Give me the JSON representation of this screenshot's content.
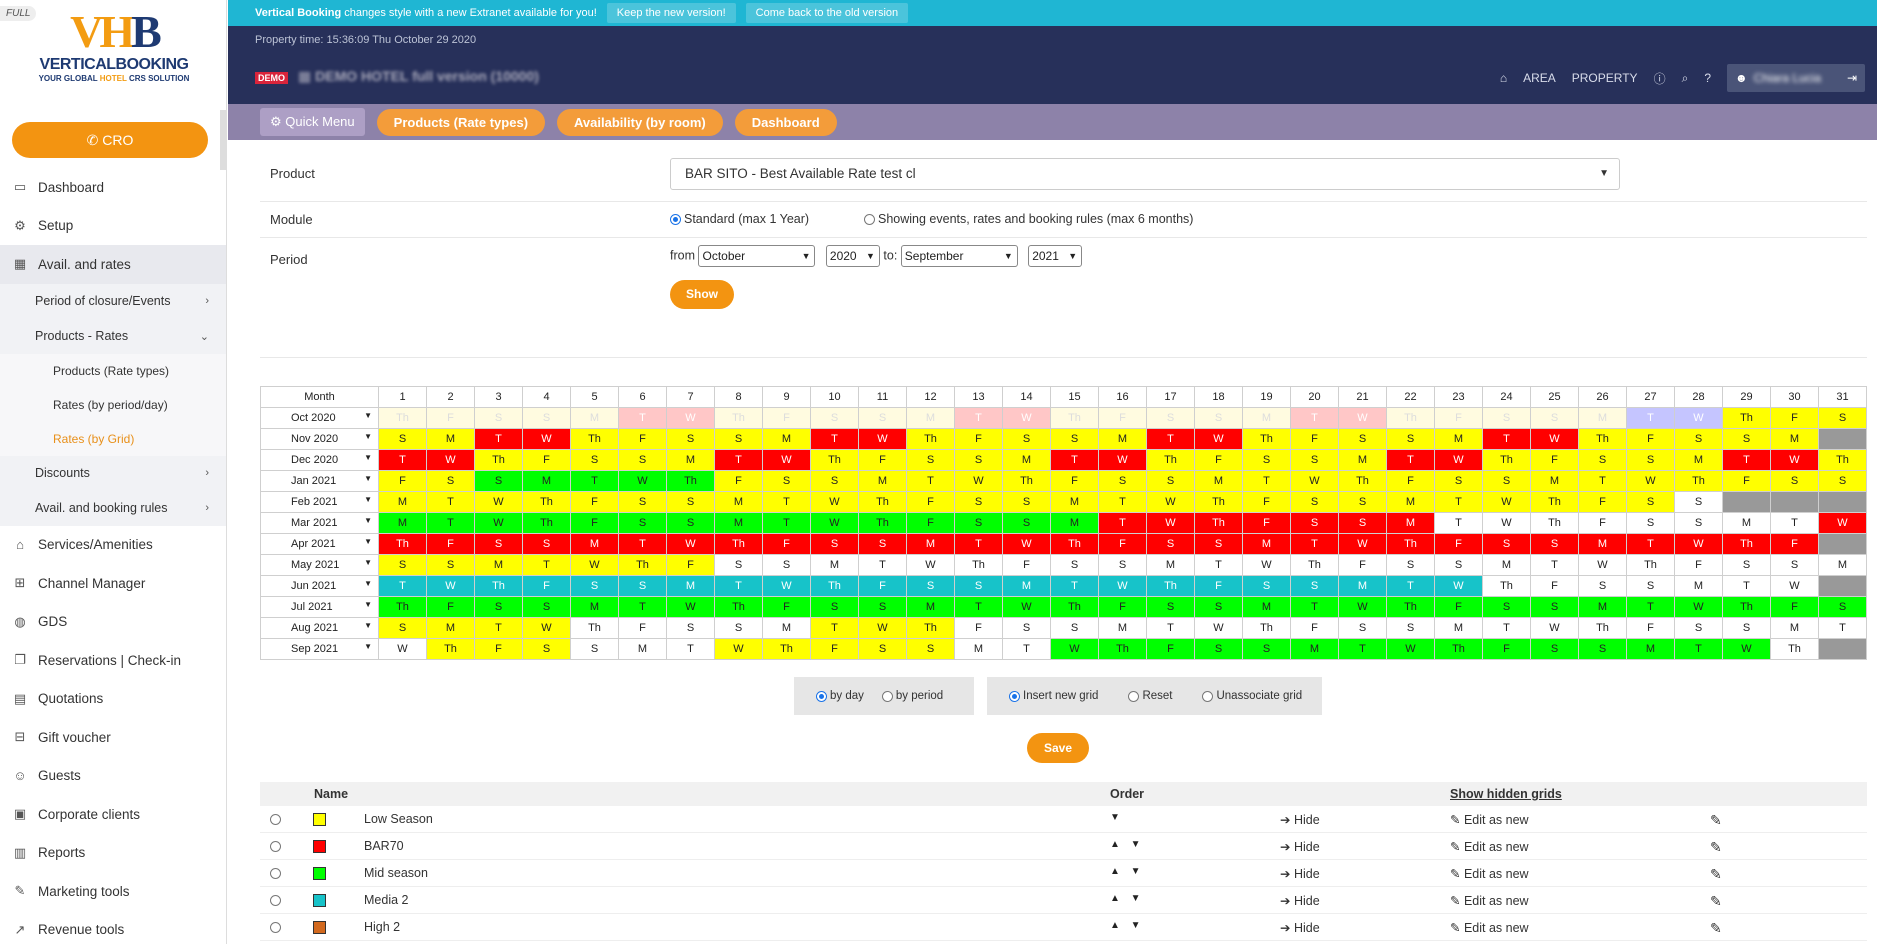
{
  "sidebar": {
    "badge": "FULL",
    "logo": {
      "mark_v": "V",
      "mark_h": "H",
      "mark_b": "B",
      "name": "VERTICALBOOKING",
      "sub_a": "YOUR GLOBAL ",
      "sub_b": "HOTEL",
      "sub_c": " CRS SOLUTION"
    },
    "cro_label": "CRO",
    "items": [
      {
        "label": "Dashboard",
        "icon": "monitor-icon"
      },
      {
        "label": "Setup",
        "icon": "gears-icon"
      },
      {
        "label": "Avail. and rates",
        "icon": "table-icon"
      },
      {
        "label": "Period of closure/Events"
      },
      {
        "label": "Products - Rates"
      },
      {
        "label": "Products (Rate types)"
      },
      {
        "label": "Rates (by period/day)"
      },
      {
        "label": "Rates (by Grid)"
      },
      {
        "label": "Discounts"
      },
      {
        "label": "Avail. and booking rules"
      },
      {
        "label": "Services/Amenities",
        "icon": "bed-icon"
      },
      {
        "label": "Channel Manager",
        "icon": "sitemap-icon"
      },
      {
        "label": "GDS",
        "icon": "globe-icon"
      },
      {
        "label": "Reservations | Check-in",
        "icon": "copy-icon"
      },
      {
        "label": "Quotations",
        "icon": "file-icon"
      },
      {
        "label": "Gift voucher",
        "icon": "gift-icon"
      },
      {
        "label": "Guests",
        "icon": "user-icon"
      },
      {
        "label": "Corporate clients",
        "icon": "briefcase-icon"
      },
      {
        "label": "Reports",
        "icon": "chart-icon"
      },
      {
        "label": "Marketing tools",
        "icon": "wrench-icon"
      },
      {
        "label": "Revenue tools",
        "icon": "trend-icon"
      }
    ]
  },
  "banner": {
    "brand": "Vertical Booking",
    "message": " changes style with a new Extranet available for you!",
    "keep": "Keep the new version!",
    "back": "Come back to the old version"
  },
  "header": {
    "property_time": "Property time: 15:36:09 Thu October 29 2020",
    "demo": "DEMO",
    "hotel": "DEMO HOTEL full version (10000)",
    "area": "AREA",
    "property": "PROPERTY",
    "user": "Chiara Lucia"
  },
  "toolbar": {
    "quick_menu": "Quick Menu",
    "products": "Products (Rate types)",
    "availability": "Availability (by room)",
    "dashboard": "Dashboard"
  },
  "form": {
    "product_label": "Product",
    "product_value": "BAR SITO - Best Available Rate test cl",
    "module_label": "Module",
    "module_std": "Standard (max 1 Year)",
    "module_events": "Showing events, rates and booking rules (max 6 months)",
    "period_label": "Period",
    "from": "from",
    "from_month": "October",
    "from_year": "2020",
    "to": "to:",
    "to_month": "September",
    "to_year": "2021",
    "show": "Show"
  },
  "grid": {
    "month_header": "Month",
    "days": [
      "1",
      "2",
      "3",
      "4",
      "5",
      "6",
      "7",
      "8",
      "9",
      "10",
      "11",
      "12",
      "13",
      "14",
      "15",
      "16",
      "17",
      "18",
      "19",
      "20",
      "21",
      "22",
      "23",
      "24",
      "25",
      "26",
      "27",
      "28",
      "29",
      "30",
      "31"
    ],
    "rows": [
      {
        "month": "Oct 2020",
        "cells": [
          "Th:ly",
          "F:ly",
          "S:ly",
          "S:ly",
          "M:ly",
          "T:lr",
          "W:lr",
          "Th:ly",
          "F:ly",
          "S:ly",
          "S:ly",
          "M:ly",
          "T:lr",
          "W:lr",
          "Th:ly",
          "F:ly",
          "S:ly",
          "S:ly",
          "M:ly",
          "T:lr",
          "W:lr",
          "Th:ly",
          "F:ly",
          "S:ly",
          "S:ly",
          "M:ly",
          "T:lv",
          "W:lv",
          "Th:y",
          "F:y",
          "S:y"
        ]
      },
      {
        "month": "Nov 2020",
        "cells": [
          "S:y",
          "M:y",
          "T:r",
          "W:r",
          "Th:y",
          "F:y",
          "S:y",
          "S:y",
          "M:y",
          "T:r",
          "W:r",
          "Th:y",
          "F:y",
          "S:y",
          "S:y",
          "M:y",
          "T:r",
          "W:r",
          "Th:y",
          "F:y",
          "S:y",
          "S:y",
          "M:y",
          "T:r",
          "W:r",
          "Th:y",
          "F:y",
          "S:y",
          "S:y",
          "M:y",
          ":gr"
        ]
      },
      {
        "month": "Dec 2020",
        "cells": [
          "T:r",
          "W:r",
          "Th:y",
          "F:y",
          "S:y",
          "S:y",
          "M:y",
          "T:r",
          "W:r",
          "Th:y",
          "F:y",
          "S:y",
          "S:y",
          "M:y",
          "T:r",
          "W:r",
          "Th:y",
          "F:y",
          "S:y",
          "S:y",
          "M:y",
          "T:r",
          "W:r",
          "Th:y",
          "F:y",
          "S:y",
          "S:y",
          "M:y",
          "T:r",
          "W:r",
          "Th:y"
        ]
      },
      {
        "month": "Jan 2021",
        "cells": [
          "F:y",
          "S:y",
          "S:g",
          "M:g",
          "T:g",
          "W:g",
          "Th:g",
          "F:y",
          "S:y",
          "S:y",
          "M:y",
          "T:y",
          "W:y",
          "Th:y",
          "F:y",
          "S:y",
          "S:y",
          "M:y",
          "T:y",
          "W:y",
          "Th:y",
          "F:y",
          "S:y",
          "S:y",
          "M:y",
          "T:y",
          "W:y",
          "Th:y",
          "F:y",
          "S:y",
          "S:y"
        ]
      },
      {
        "month": "Feb 2021",
        "cells": [
          "M:y",
          "T:y",
          "W:y",
          "Th:y",
          "F:y",
          "S:y",
          "S:y",
          "M:y",
          "T:y",
          "W:y",
          "Th:y",
          "F:y",
          "S:y",
          "S:y",
          "M:y",
          "T:y",
          "W:y",
          "Th:y",
          "F:y",
          "S:y",
          "S:y",
          "M:y",
          "T:y",
          "W:y",
          "Th:y",
          "F:y",
          "S:y",
          "S:w",
          ":gr",
          ":gr",
          ":gr"
        ]
      },
      {
        "month": "Mar 2021",
        "cells": [
          "M:g",
          "T:g",
          "W:g",
          "Th:g",
          "F:g",
          "S:g",
          "S:g",
          "M:g",
          "T:g",
          "W:g",
          "Th:g",
          "F:g",
          "S:g",
          "S:g",
          "M:g",
          "T:r",
          "W:r",
          "Th:r",
          "F:r",
          "S:r",
          "S:r",
          "M:r",
          "T:w",
          "W:w",
          "Th:w",
          "F:w",
          "S:w",
          "S:w",
          "M:w",
          "T:w",
          "W:r"
        ]
      },
      {
        "month": "Apr 2021",
        "cells": [
          "Th:r",
          "F:r",
          "S:r",
          "S:r",
          "M:r",
          "T:r",
          "W:r",
          "Th:r",
          "F:r",
          "S:r",
          "S:r",
          "M:r",
          "T:r",
          "W:r",
          "Th:r",
          "F:r",
          "S:r",
          "S:r",
          "M:r",
          "T:r",
          "W:r",
          "Th:r",
          "F:r",
          "S:r",
          "S:r",
          "M:r",
          "T:r",
          "W:r",
          "Th:r",
          "F:r",
          ":gr"
        ]
      },
      {
        "month": "May 2021",
        "cells": [
          "S:y",
          "S:y",
          "M:y",
          "T:y",
          "W:y",
          "Th:y",
          "F:y",
          "S:w",
          "S:w",
          "M:w",
          "T:w",
          "W:w",
          "Th:w",
          "F:w",
          "S:w",
          "S:w",
          "M:w",
          "T:w",
          "W:w",
          "Th:w",
          "F:w",
          "S:w",
          "S:w",
          "M:w",
          "T:w",
          "W:w",
          "Th:w",
          "F:w",
          "S:w",
          "S:w",
          "M:w"
        ]
      },
      {
        "month": "Jun 2021",
        "cells": [
          "T:c",
          "W:c",
          "Th:c",
          "F:c",
          "S:c",
          "S:c",
          "M:c",
          "T:c",
          "W:c",
          "Th:c",
          "F:c",
          "S:c",
          "S:c",
          "M:c",
          "T:c",
          "W:c",
          "Th:c",
          "F:c",
          "S:c",
          "S:c",
          "M:c",
          "T:c",
          "W:c",
          "Th:w",
          "F:w",
          "S:w",
          "S:w",
          "M:w",
          "T:w",
          "W:w",
          ":gr"
        ]
      },
      {
        "month": "Jul 2021",
        "cells": [
          "Th:g",
          "F:g",
          "S:g",
          "S:g",
          "M:g",
          "T:g",
          "W:g",
          "Th:g",
          "F:g",
          "S:g",
          "S:g",
          "M:g",
          "T:g",
          "W:g",
          "Th:g",
          "F:g",
          "S:g",
          "S:g",
          "M:g",
          "T:g",
          "W:g",
          "Th:g",
          "F:g",
          "S:g",
          "S:g",
          "M:g",
          "T:g",
          "W:g",
          "Th:g",
          "F:g",
          "S:g"
        ]
      },
      {
        "month": "Aug 2021",
        "cells": [
          "S:y",
          "M:y",
          "T:y",
          "W:y",
          "Th:w",
          "F:w",
          "S:w",
          "S:w",
          "M:w",
          "T:y",
          "W:y",
          "Th:y",
          "F:w",
          "S:w",
          "S:w",
          "M:w",
          "T:w",
          "W:w",
          "Th:w",
          "F:w",
          "S:w",
          "S:w",
          "M:w",
          "T:w",
          "W:w",
          "Th:w",
          "F:w",
          "S:w",
          "S:w",
          "M:w",
          "T:w"
        ]
      },
      {
        "month": "Sep 2021",
        "cells": [
          "W:w",
          "Th:y",
          "F:y",
          "S:y",
          "S:w",
          "M:w",
          "T:w",
          "W:y",
          "Th:y",
          "F:y",
          "S:y",
          "S:y",
          "M:w",
          "T:w",
          "W:g",
          "Th:g",
          "F:g",
          "S:g",
          "S:g",
          "M:g",
          "T:g",
          "W:g",
          "Th:g",
          "F:g",
          "S:g",
          "S:g",
          "M:g",
          "T:g",
          "W:g",
          "Th:w",
          ":gr"
        ]
      }
    ]
  },
  "options": {
    "by_day": "by day",
    "by_period": "by period",
    "insert": "Insert new grid",
    "reset": "Reset",
    "unassociate": "Unassociate grid",
    "save": "Save"
  },
  "list": {
    "name_header": "Name",
    "order_header": "Order",
    "hidden_header": "Show hidden grids",
    "rows": [
      {
        "name": "Low Season",
        "color": "#ffff00",
        "order": "▼"
      },
      {
        "name": "BAR70",
        "color": "#ff0000",
        "order": "▲ ▼"
      },
      {
        "name": "Mid season",
        "color": "#00ff00",
        "order": "▲ ▼"
      },
      {
        "name": "Media 2",
        "color": "#17c3c9",
        "order": "▲ ▼"
      },
      {
        "name": "High 2",
        "color": "#d2691e",
        "order": "▲ ▼"
      }
    ],
    "hide": "Hide",
    "edit_new": "Edit as new"
  }
}
